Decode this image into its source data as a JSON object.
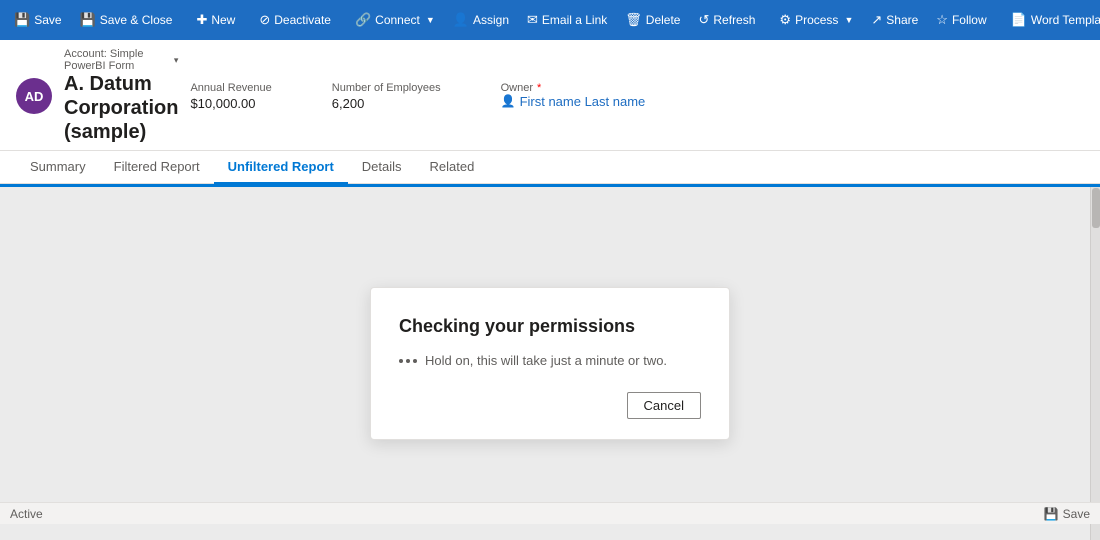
{
  "toolbar": {
    "buttons": [
      {
        "id": "save",
        "label": "Save",
        "icon": "💾"
      },
      {
        "id": "save-close",
        "label": "Save & Close",
        "icon": "💾"
      },
      {
        "id": "new",
        "label": "New",
        "icon": "➕"
      },
      {
        "id": "deactivate",
        "label": "Deactivate",
        "icon": "🚫"
      },
      {
        "id": "connect",
        "label": "Connect",
        "icon": "🔗",
        "dropdown": true
      },
      {
        "id": "assign",
        "label": "Assign",
        "icon": "👤"
      },
      {
        "id": "email-link",
        "label": "Email a Link",
        "icon": "✉"
      },
      {
        "id": "delete",
        "label": "Delete",
        "icon": "🗑"
      },
      {
        "id": "refresh",
        "label": "Refresh",
        "icon": "🔄"
      },
      {
        "id": "process",
        "label": "Process",
        "icon": "⚙",
        "dropdown": true
      },
      {
        "id": "share",
        "label": "Share",
        "icon": "↗"
      },
      {
        "id": "follow",
        "label": "Follow",
        "icon": "⭐"
      },
      {
        "id": "word-templates",
        "label": "Word Templates",
        "icon": "📄",
        "dropdown": true
      }
    ]
  },
  "entity": {
    "avatar_initials": "AD",
    "form_label": "Account: Simple PowerBI Form",
    "name": "A. Datum Corporation (sample)",
    "fields": [
      {
        "id": "annual-revenue",
        "label": "Annual Revenue",
        "value": "$10,000.00"
      },
      {
        "id": "num-employees",
        "label": "Number of Employees",
        "value": "6,200"
      }
    ],
    "owner": {
      "label": "Owner",
      "value": "First name Last name"
    }
  },
  "tabs": [
    {
      "id": "summary",
      "label": "Summary",
      "active": false
    },
    {
      "id": "filtered-report",
      "label": "Filtered Report",
      "active": false
    },
    {
      "id": "unfiltered-report",
      "label": "Unfiltered Report",
      "active": true
    },
    {
      "id": "details",
      "label": "Details",
      "active": false
    },
    {
      "id": "related",
      "label": "Related",
      "active": false
    }
  ],
  "modal": {
    "title": "Checking your permissions",
    "body_text": "Hold on, this will take just a minute or two.",
    "cancel_label": "Cancel"
  },
  "status_bar": {
    "status_label": "Active",
    "save_label": "Save"
  }
}
